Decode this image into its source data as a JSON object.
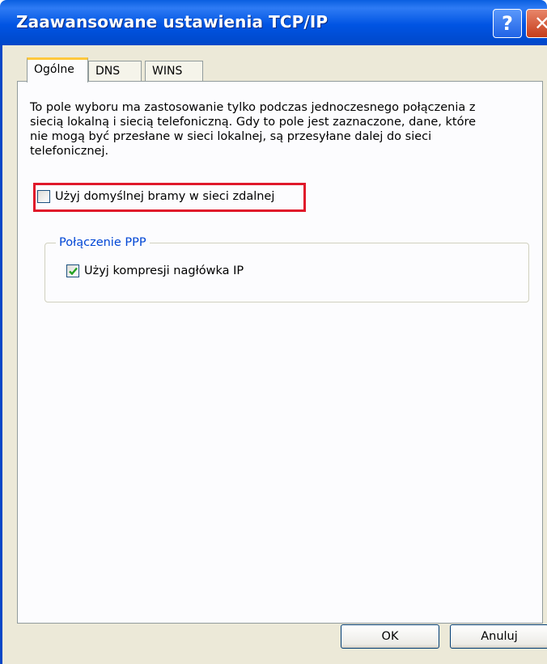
{
  "window": {
    "title": "Zaawansowane ustawienia TCP/IP",
    "help_label": "?",
    "close_label": "✕"
  },
  "tabs": [
    {
      "label": "Ogólne",
      "active": true
    },
    {
      "label": "DNS",
      "active": false
    },
    {
      "label": "WINS",
      "active": false
    }
  ],
  "general": {
    "description": "To pole wyboru ma zastosowanie tylko podczas jednoczesnego połączenia z siecią lokalną i siecią telefoniczną. Gdy to pole jest zaznaczone, dane, które nie mogą być przesłane w sieci lokalnej, są przesyłane dalej do sieci telefonicznej.",
    "default_gateway": {
      "label": "Użyj domyślnej bramy w sieci zdalnej",
      "checked": false
    },
    "ppp_group": {
      "title": "Połączenie PPP",
      "header_compression": {
        "label": "Użyj kompresji nagłówka IP",
        "checked": true
      }
    }
  },
  "buttons": {
    "ok": "OK",
    "cancel": "Anuluj"
  },
  "colors": {
    "titlebar": "#0054e3",
    "highlight": "#e0182a",
    "group_title": "#0046d5",
    "check": "#21a121"
  }
}
